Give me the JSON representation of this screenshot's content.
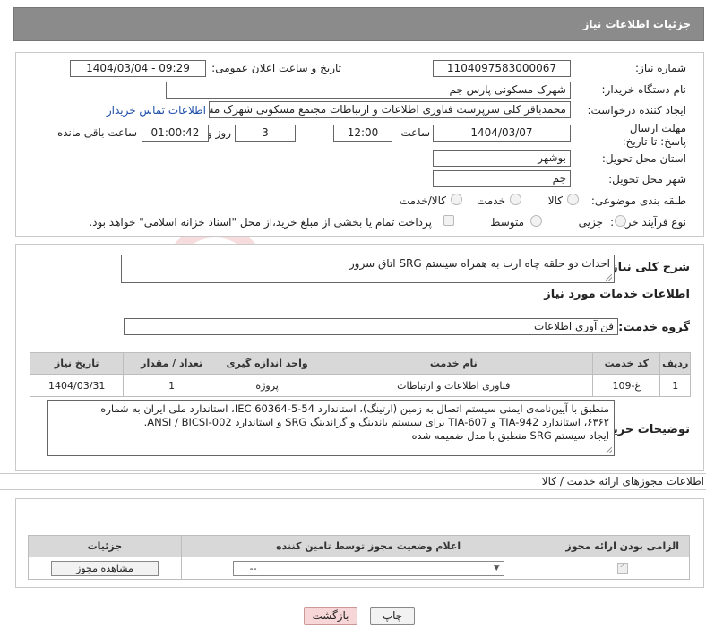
{
  "header": {
    "title": "جزئیات اطلاعات نیاز"
  },
  "form": {
    "need_number_label": "شماره نیاز:",
    "need_number": "1104097583000067",
    "announce_label": "تاریخ و ساعت اعلان عمومی:",
    "announce_value": "1404/03/04 - 09:29",
    "buyer_org_label": "نام دستگاه خریدار:",
    "buyer_org": "شهرک مسکونی پارس جم",
    "creator_label": "ایجاد کننده درخواست:",
    "creator": "محمدباقر کلی سرپرست فناوری اطلاعات و ارتباطات مجتمع مسکونی شهرک مسکونی پارس جم",
    "contact_link": "اطلاعات تماس خریدار",
    "deadline_label": "مهلت ارسال پاسخ: تا تاریخ:",
    "deadline_date": "1404/03/07",
    "time_label": "ساعت",
    "deadline_time": "12:00",
    "days_value": "3",
    "days_label": "روز و",
    "remaining_time": "01:00:42",
    "remaining_label": "ساعت باقی مانده",
    "province_label": "استان محل تحویل:",
    "province": "بوشهر",
    "city_label": "شهر محل تحویل:",
    "city": "جم",
    "category_label": "طبقه بندی موضوعی:",
    "category_options": [
      "کالا",
      "خدمت",
      "کالا/خدمت"
    ],
    "process_label": "نوع فرآیند خرید :",
    "process_options": [
      "جزیی",
      "متوسط"
    ],
    "payment_note": "پرداخت تمام یا بخشی از مبلغ خرید،از محل \"اسناد خزانه اسلامی\" خواهد بود."
  },
  "summary": {
    "label": "شرح کلی نیاز:",
    "text": "احداث دو حلقه چاه ارت به همراه سیستم SRG اتاق سرور"
  },
  "services": {
    "section_title": "اطلاعات خدمات مورد نیاز",
    "group_label": "گروه خدمت:",
    "group_value": "فن آوری اطلاعات",
    "columns": [
      "ردیف",
      "کد خدمت",
      "نام خدمت",
      "واحد اندازه گیری",
      "تعداد / مقدار",
      "تاریخ نیاز"
    ],
    "rows": [
      [
        "1",
        "غ-109",
        "فناوری اطلاعات و ارتباطات",
        "پروژه",
        "1",
        "1404/03/31"
      ]
    ]
  },
  "buyer_notes": {
    "label": "توضیحات خریدار:",
    "lines": [
      "منطبق با آیین‌نامه‌ی ایمنی سیستم اتصال به زمین (ارتینگ)، استاندارد IEC 60364-5-54، استاندارد ملی ایران به شماره",
      "۶۳۶۲، استاندارد TIA-942 و TIA-607 برای سیستم باندینگ و گراندینگ SRG و استاندارد ANSI / BICSI-002.",
      "ایجاد سیستم SRG منطبق با مدل ضمیمه شده"
    ]
  },
  "permits": {
    "section_title": "اطلاعات مجوزهای ارائه خدمت / کالا",
    "columns": [
      "الزامی بودن ارائه مجوز",
      "اعلام وضعیت مجوز توسط تامین کننده",
      "جزئیات"
    ],
    "select_value": "--",
    "view_button": "مشاهده مجوز"
  },
  "actions": {
    "print": "چاپ",
    "back": "بازگشت"
  },
  "watermark": {
    "text": "AriaTender.neT"
  },
  "colors": {
    "header_bg": "#8b8b8b",
    "link": "#1f4fa8",
    "back_btn_bg": "#f6d6d6",
    "watermark": "#c92a2a"
  }
}
